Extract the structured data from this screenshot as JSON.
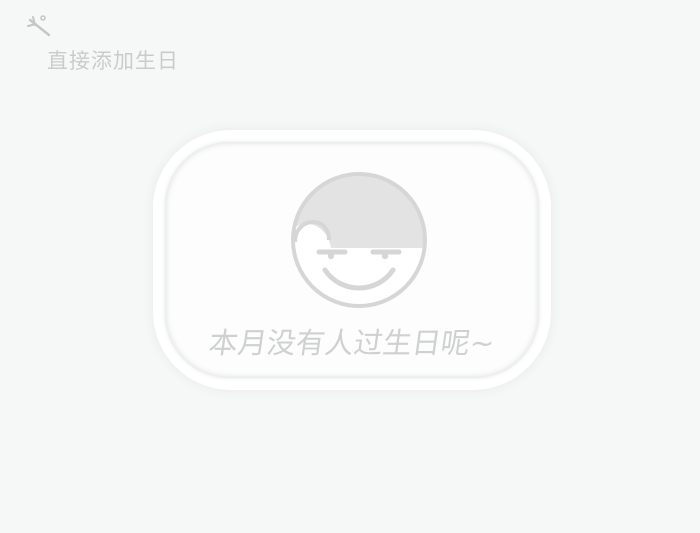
{
  "toolbar": {
    "quick_add_icon": "wand-icon",
    "quick_add_label": "直接添加生日"
  },
  "empty_state": {
    "illustration": "smiley-face-icon",
    "message": "本月没有人过生日呢~"
  },
  "colors": {
    "background": "#f6f8f8",
    "muted_text": "#c9cccc",
    "card": "#ffffff",
    "face_fill": "#e3e3e3",
    "face_stroke": "#d6d6d6"
  }
}
